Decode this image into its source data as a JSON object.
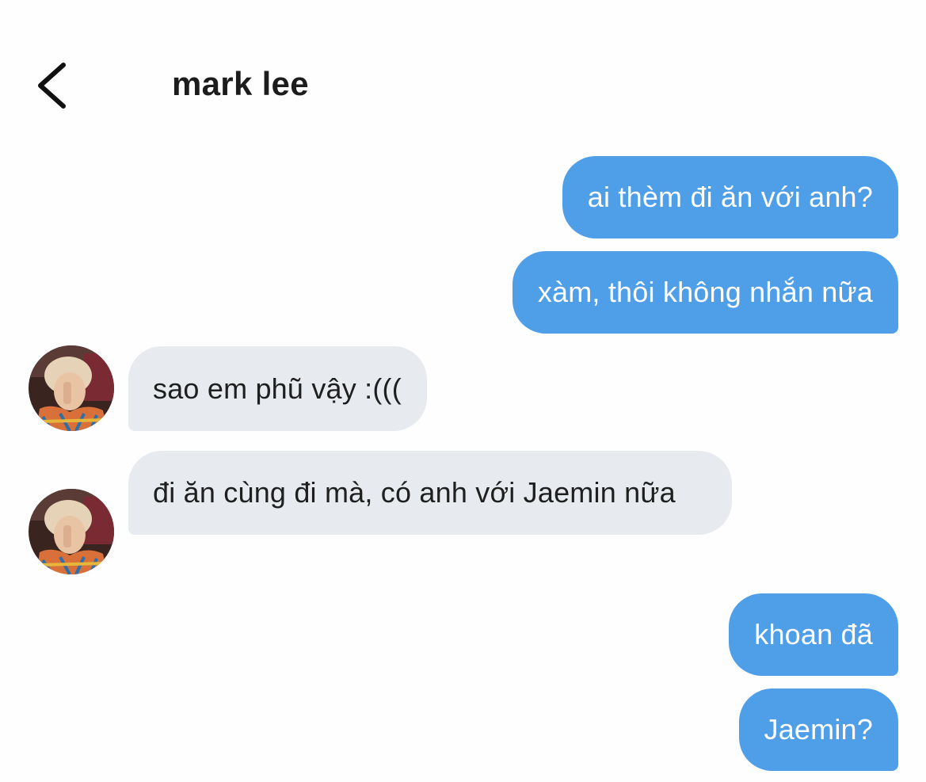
{
  "header": {
    "title": "mark lee",
    "back_icon": "chevron-left-icon"
  },
  "messages": [
    {
      "sender": "me",
      "text": "ai thèm đi ăn với anh?"
    },
    {
      "sender": "me",
      "text": "xàm, thôi không nhắn nữa"
    },
    {
      "sender": "contact",
      "text": "sao em phũ vậy :((("
    },
    {
      "sender": "contact",
      "text": "đi ăn cùng đi mà, có anh với Jaemin nữa"
    },
    {
      "sender": "me",
      "text": "khoan đã"
    },
    {
      "sender": "me",
      "text": "Jaemin?"
    }
  ],
  "colors": {
    "sent_bubble": "#4e9ee8",
    "received_bubble": "#e7ebef",
    "sent_text": "#ffffff",
    "received_text": "#1f1f1f",
    "title_text": "#1c1c1c"
  }
}
